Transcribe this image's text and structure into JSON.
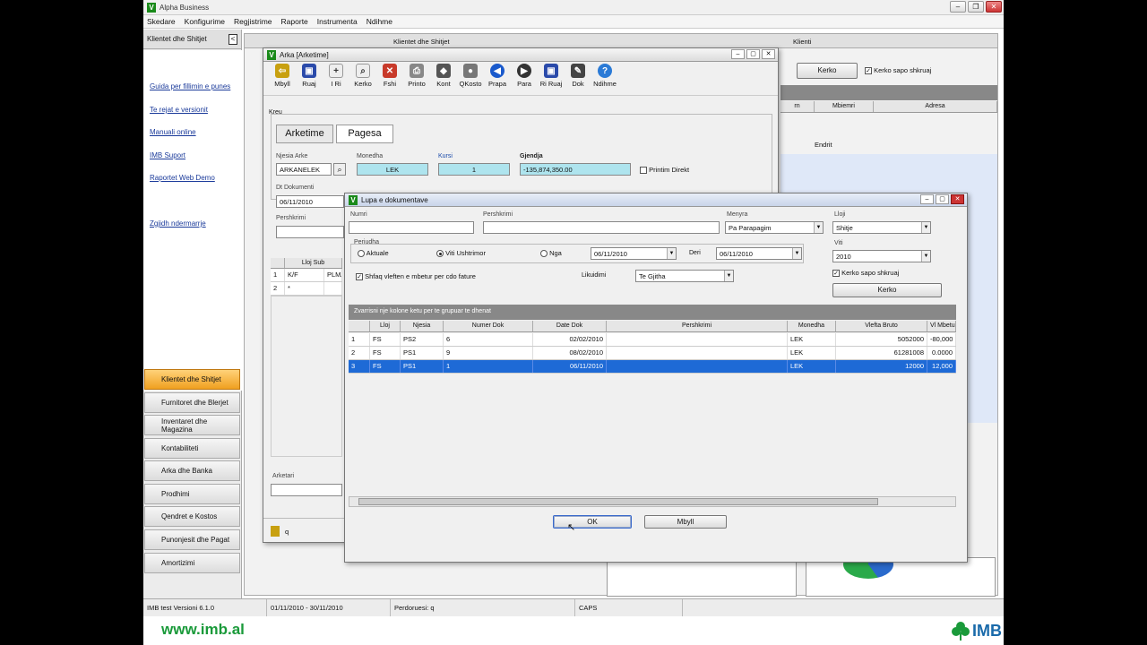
{
  "app": {
    "title": "Alpha Business",
    "logo_letter": "V"
  },
  "menu": [
    "Skedare",
    "Konfigurime",
    "Regjistrime",
    "Raporte",
    "Instrumenta",
    "Ndihme"
  ],
  "left_panel": {
    "header": "Klientet dhe Shitjet",
    "collapse": "<",
    "links": [
      "Guida per fillimin e punes",
      "Te rejat e versionit",
      "Manuali online",
      "IMB Suport",
      "Raportet Web Demo",
      "Zgjidh ndermarrje"
    ],
    "nav": [
      "Klientet dhe Shitjet",
      "Furnitoret dhe Blerjet",
      "Inventaret dhe Magazina",
      "Kontabiliteti",
      "Arka dhe Banka",
      "Prodhimi",
      "Qendret e Kostos",
      "Punonjesit dhe Pagat",
      "Amortizimi"
    ]
  },
  "bg_window": {
    "title_left": "Klientet dhe Shitjet",
    "title_right": "Klienti",
    "search_button": "Kerko",
    "search_check": "Kerko sapo shkruaj",
    "col_mbiemri": "Mbiemri",
    "col_adresa": "Adresa",
    "col_em": "rn",
    "cell_endrit": "Endrit",
    "partial_text": "ndrit"
  },
  "arka": {
    "title": "Arka [Arketime]",
    "toolbar": [
      "Mbyll",
      "Ruaj",
      "I Ri",
      "Kerko",
      "Fshi",
      "Printo",
      "Kont",
      "QKosto",
      "Prapa",
      "Para",
      "Ri Ruaj",
      "Dok",
      "Ndihme"
    ],
    "group": "Kreu",
    "tabs": [
      "Arketime",
      "Pagesa"
    ],
    "njesia_label": "Njesia Arke",
    "njesia_value": "ARKANELEK",
    "monedha_label": "Monedha",
    "monedha_value": "LEK",
    "kursi_label": "Kursi",
    "kursi_value": "1",
    "gjendja_label": "Gjendja",
    "gjendja_value": "-135,874,350.00",
    "printim": "Printim Direkt",
    "dt_label": "Dt Dokumenti",
    "dt_value": "06/11/2010",
    "pershkrimi_label": "Pershkrimi",
    "grid_head": [
      "Lloj Sub"
    ],
    "grid_rows": [
      [
        "1",
        "K/F",
        "PLMA"
      ],
      [
        "2",
        "*",
        ""
      ]
    ],
    "arketari": "Arketari",
    "user": "q"
  },
  "lupa": {
    "title": "Lupa e dokumentave",
    "numri_label": "Numri",
    "pershkrimi_label": "Pershkrimi",
    "menyra_label": "Menyra",
    "menyra_value": "Pa Parapagim",
    "lloji_label": "Lloji",
    "lloji_value": "Shitje",
    "periudha_label": "Periudha",
    "aktuale": "Aktuale",
    "viti": "Viti Ushtrimor",
    "nga": "Nga",
    "nga_date": "06/11/2010",
    "deri": "Deri",
    "deri_date": "06/11/2010",
    "viti_label": "Viti",
    "viti_value": "2010",
    "shfaq": "Shfaq vleften e mbetur per cdo fature",
    "likuidimi_label": "Likuidimi",
    "likuidimi_value": "Te Gjitha",
    "kerko_check": "Kerko sapo shkruaj",
    "kerko_button": "Kerko",
    "group_hint": "Zvarrisni nje kolone ketu per te grupuar te dhenat",
    "columns": [
      "Lloj",
      "Njesia",
      "Numer Dok",
      "Date Dok",
      "Pershkrimi",
      "Monedha",
      "Vlefta Bruto",
      "Vl Mbetur"
    ],
    "rows": [
      [
        "1",
        "FS",
        "PS2",
        "6",
        "02/02/2010",
        "",
        "LEK",
        "5052000",
        "-80,000"
      ],
      [
        "2",
        "FS",
        "PS1",
        "9",
        "08/02/2010",
        "",
        "LEK",
        "61281008",
        "0.0000"
      ],
      [
        "3",
        "FS",
        "PS1",
        "1",
        "06/11/2010",
        "",
        "LEK",
        "12000",
        "12,000"
      ]
    ],
    "ok": "OK",
    "mbyll": "Mbyll"
  },
  "status": [
    "IMB test  Versioni 6.1.0",
    "01/11/2010 - 30/11/2010",
    "Perdoruesi: q",
    "CAPS"
  ],
  "footer": {
    "site": "www.imb.al",
    "brand": "IMB"
  },
  "colors": {
    "active_nav": "#f0a020",
    "selection": "#1e6ad6",
    "cyan_field": "#aee4ee",
    "brand_green": "#1a9a3a"
  }
}
